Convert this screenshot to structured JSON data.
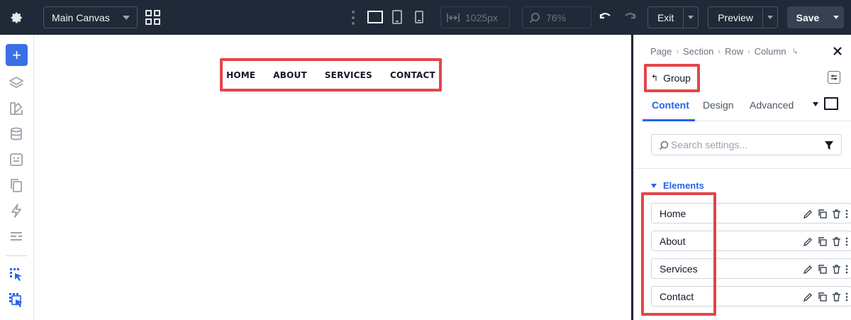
{
  "topbar": {
    "canvas_select": "Main Canvas",
    "width_value": "1025px",
    "zoom_value": "76%",
    "exit_label": "Exit",
    "preview_label": "Preview",
    "save_label": "Save",
    "icons": [
      "gear-icon",
      "grid-icon",
      "more-vertical-icon",
      "desktop-icon",
      "tablet-icon",
      "mobile-icon",
      "width-icon",
      "zoom-icon",
      "undo-icon",
      "redo-icon"
    ]
  },
  "sidebar": {
    "icons": [
      "add-icon",
      "layers-icon",
      "palette-icon",
      "database-icon",
      "template-icon",
      "pages-icon",
      "lightning-icon",
      "list-icon",
      "cursor-select-icon",
      "cursor-select-multi-icon"
    ]
  },
  "canvas": {
    "nav_items": [
      "HOME",
      "ABOUT",
      "SERVICES",
      "CONTACT"
    ]
  },
  "panel": {
    "breadcrumb": [
      "Page",
      "Section",
      "Row",
      "Column"
    ],
    "group_title": "Group",
    "tabs": [
      "Content",
      "Design",
      "Advanced"
    ],
    "active_tab": "Content",
    "search_placeholder": "Search settings...",
    "elements_heading": "Elements",
    "elements": [
      "Home",
      "About",
      "Services",
      "Contact"
    ]
  },
  "colors": {
    "topbar_bg": "#1f2937",
    "accent": "#2563eb",
    "highlight": "#e3454a"
  }
}
